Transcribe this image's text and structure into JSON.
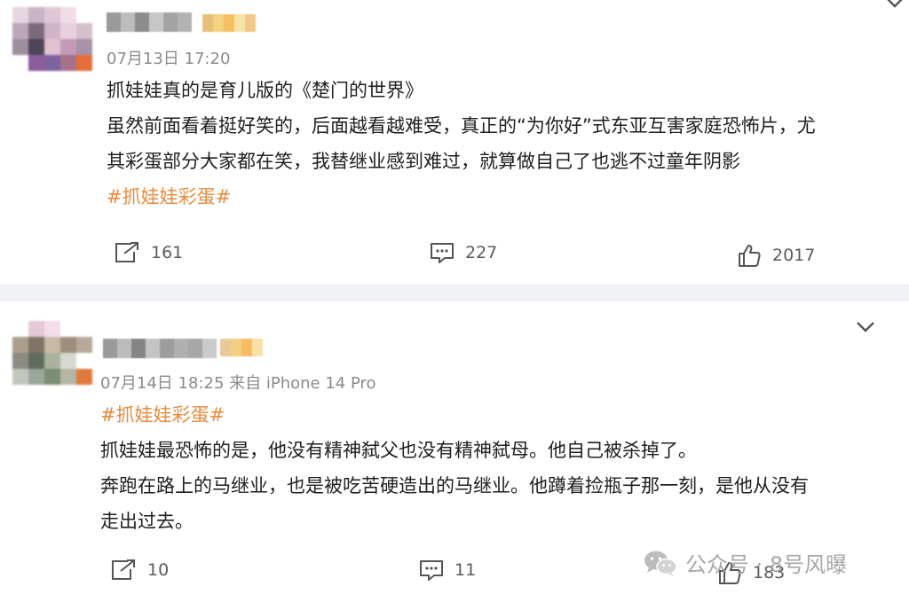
{
  "posts": [
    {
      "meta": "07月13日 17:20",
      "line1": "抓娃娃真的是育儿版的《楚门的世界》",
      "line2": "虽然前面看着挺好笑的，后面越看越难受，真正的“为你好”式东亚互害家庭恐怖片，尤",
      "line3": "其彩蛋部分大家都在笑，我替继业感到难过，就算做自己了也逃不过童年阴影",
      "hashtag": "#抓娃娃彩蛋#",
      "shares": "161",
      "comments": "227",
      "likes": "2017"
    },
    {
      "meta": "07月14日 18:25  来自 iPhone 14 Pro",
      "hashtag": "#抓娃娃彩蛋#",
      "line1": "抓娃娃最恐怖的是，他没有精神弑父也没有精神弑母。他自己被杀掉了。",
      "line2": "奔跑在路上的马继业，也是被吃苦硬造出的马继业。他蹲着捡瓶子那一刻，是他从没有",
      "line3": "走出过去。",
      "shares": "10",
      "comments": "11",
      "likes": "183"
    }
  ],
  "watermark": {
    "text": "公众号 · 8号风曝"
  },
  "icons": [
    "share-icon",
    "comment-icon",
    "like-icon",
    "chevron-down-icon",
    "wechat-icon"
  ],
  "colors": {
    "hashtag": "#e98a3c",
    "meta": "#8a8a8a",
    "separator": "#f1f2f5"
  }
}
